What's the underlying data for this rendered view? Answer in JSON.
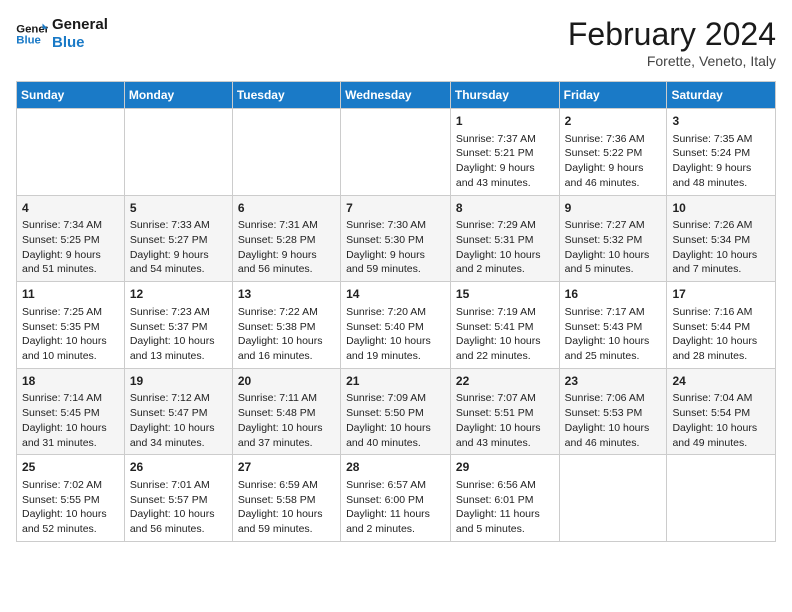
{
  "header": {
    "logo_general": "General",
    "logo_blue": "Blue",
    "month_title": "February 2024",
    "subtitle": "Forette, Veneto, Italy"
  },
  "weekdays": [
    "Sunday",
    "Monday",
    "Tuesday",
    "Wednesday",
    "Thursday",
    "Friday",
    "Saturday"
  ],
  "weeks": [
    [
      {
        "day": "",
        "info": ""
      },
      {
        "day": "",
        "info": ""
      },
      {
        "day": "",
        "info": ""
      },
      {
        "day": "",
        "info": ""
      },
      {
        "day": "1",
        "info": "Sunrise: 7:37 AM\nSunset: 5:21 PM\nDaylight: 9 hours\nand 43 minutes."
      },
      {
        "day": "2",
        "info": "Sunrise: 7:36 AM\nSunset: 5:22 PM\nDaylight: 9 hours\nand 46 minutes."
      },
      {
        "day": "3",
        "info": "Sunrise: 7:35 AM\nSunset: 5:24 PM\nDaylight: 9 hours\nand 48 minutes."
      }
    ],
    [
      {
        "day": "4",
        "info": "Sunrise: 7:34 AM\nSunset: 5:25 PM\nDaylight: 9 hours\nand 51 minutes."
      },
      {
        "day": "5",
        "info": "Sunrise: 7:33 AM\nSunset: 5:27 PM\nDaylight: 9 hours\nand 54 minutes."
      },
      {
        "day": "6",
        "info": "Sunrise: 7:31 AM\nSunset: 5:28 PM\nDaylight: 9 hours\nand 56 minutes."
      },
      {
        "day": "7",
        "info": "Sunrise: 7:30 AM\nSunset: 5:30 PM\nDaylight: 9 hours\nand 59 minutes."
      },
      {
        "day": "8",
        "info": "Sunrise: 7:29 AM\nSunset: 5:31 PM\nDaylight: 10 hours\nand 2 minutes."
      },
      {
        "day": "9",
        "info": "Sunrise: 7:27 AM\nSunset: 5:32 PM\nDaylight: 10 hours\nand 5 minutes."
      },
      {
        "day": "10",
        "info": "Sunrise: 7:26 AM\nSunset: 5:34 PM\nDaylight: 10 hours\nand 7 minutes."
      }
    ],
    [
      {
        "day": "11",
        "info": "Sunrise: 7:25 AM\nSunset: 5:35 PM\nDaylight: 10 hours\nand 10 minutes."
      },
      {
        "day": "12",
        "info": "Sunrise: 7:23 AM\nSunset: 5:37 PM\nDaylight: 10 hours\nand 13 minutes."
      },
      {
        "day": "13",
        "info": "Sunrise: 7:22 AM\nSunset: 5:38 PM\nDaylight: 10 hours\nand 16 minutes."
      },
      {
        "day": "14",
        "info": "Sunrise: 7:20 AM\nSunset: 5:40 PM\nDaylight: 10 hours\nand 19 minutes."
      },
      {
        "day": "15",
        "info": "Sunrise: 7:19 AM\nSunset: 5:41 PM\nDaylight: 10 hours\nand 22 minutes."
      },
      {
        "day": "16",
        "info": "Sunrise: 7:17 AM\nSunset: 5:43 PM\nDaylight: 10 hours\nand 25 minutes."
      },
      {
        "day": "17",
        "info": "Sunrise: 7:16 AM\nSunset: 5:44 PM\nDaylight: 10 hours\nand 28 minutes."
      }
    ],
    [
      {
        "day": "18",
        "info": "Sunrise: 7:14 AM\nSunset: 5:45 PM\nDaylight: 10 hours\nand 31 minutes."
      },
      {
        "day": "19",
        "info": "Sunrise: 7:12 AM\nSunset: 5:47 PM\nDaylight: 10 hours\nand 34 minutes."
      },
      {
        "day": "20",
        "info": "Sunrise: 7:11 AM\nSunset: 5:48 PM\nDaylight: 10 hours\nand 37 minutes."
      },
      {
        "day": "21",
        "info": "Sunrise: 7:09 AM\nSunset: 5:50 PM\nDaylight: 10 hours\nand 40 minutes."
      },
      {
        "day": "22",
        "info": "Sunrise: 7:07 AM\nSunset: 5:51 PM\nDaylight: 10 hours\nand 43 minutes."
      },
      {
        "day": "23",
        "info": "Sunrise: 7:06 AM\nSunset: 5:53 PM\nDaylight: 10 hours\nand 46 minutes."
      },
      {
        "day": "24",
        "info": "Sunrise: 7:04 AM\nSunset: 5:54 PM\nDaylight: 10 hours\nand 49 minutes."
      }
    ],
    [
      {
        "day": "25",
        "info": "Sunrise: 7:02 AM\nSunset: 5:55 PM\nDaylight: 10 hours\nand 52 minutes."
      },
      {
        "day": "26",
        "info": "Sunrise: 7:01 AM\nSunset: 5:57 PM\nDaylight: 10 hours\nand 56 minutes."
      },
      {
        "day": "27",
        "info": "Sunrise: 6:59 AM\nSunset: 5:58 PM\nDaylight: 10 hours\nand 59 minutes."
      },
      {
        "day": "28",
        "info": "Sunrise: 6:57 AM\nSunset: 6:00 PM\nDaylight: 11 hours\nand 2 minutes."
      },
      {
        "day": "29",
        "info": "Sunrise: 6:56 AM\nSunset: 6:01 PM\nDaylight: 11 hours\nand 5 minutes."
      },
      {
        "day": "",
        "info": ""
      },
      {
        "day": "",
        "info": ""
      }
    ]
  ]
}
